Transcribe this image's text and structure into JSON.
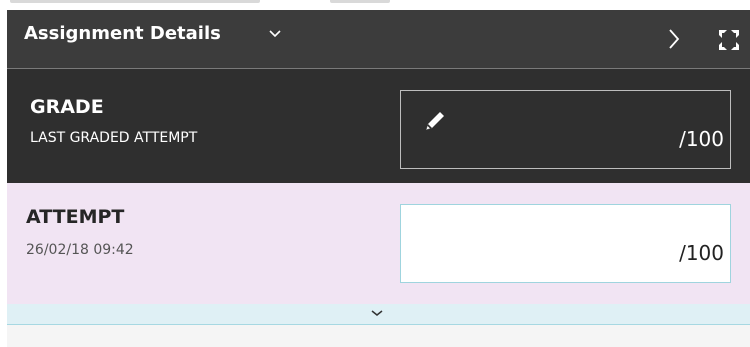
{
  "colors": {
    "header_bg": "#3c3c3c",
    "grade_bg": "#2f2f2f",
    "attempt_bg": "#f1e4f3",
    "expander_bg": "#dff0f5",
    "input_border_active": "#9fd4de"
  },
  "header": {
    "title": "Assignment Details",
    "dropdown_icon": "chevron-down-icon",
    "next_icon": "chevron-right-icon",
    "expand_icon": "expand-icon"
  },
  "grade": {
    "label": "GRADE",
    "sublabel": "LAST GRADED ATTEMPT",
    "edit_icon": "pencil-icon",
    "score_suffix": "/100"
  },
  "attempt": {
    "label": "ATTEMPT",
    "timestamp": "26/02/18 09:42",
    "score_suffix": "/100"
  },
  "expander": {
    "icon": "chevron-down-icon"
  }
}
